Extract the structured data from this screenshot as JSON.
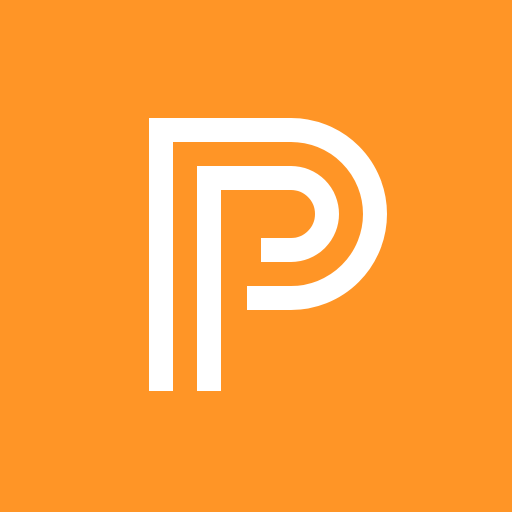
{
  "app_icon": {
    "icon": "p-logo-icon",
    "background_color": "#FF9526",
    "foreground_color": "#FFFFFF"
  }
}
